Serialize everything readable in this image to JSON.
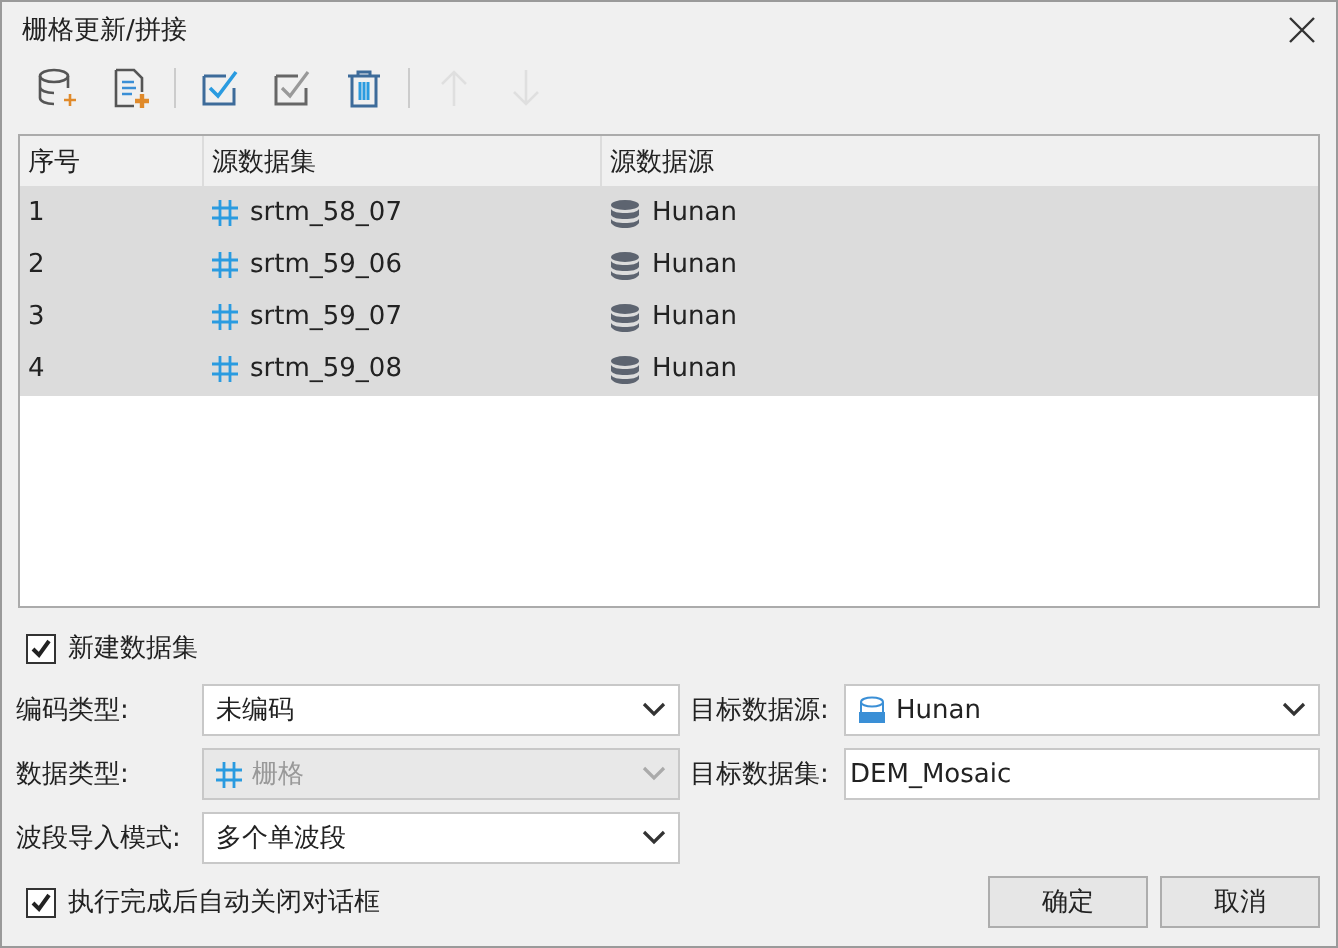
{
  "window": {
    "title": "栅格更新/拼接"
  },
  "toolbar": [
    {
      "kind": "add-datasource",
      "disabled": false
    },
    {
      "kind": "add-file",
      "disabled": false
    },
    {
      "kind": "select-all",
      "disabled": false
    },
    {
      "kind": "select-inverse",
      "disabled": false
    },
    {
      "kind": "delete",
      "disabled": false
    },
    {
      "kind": "up",
      "disabled": true
    },
    {
      "kind": "down",
      "disabled": true
    }
  ],
  "table": {
    "columns": [
      "序号",
      "源数据集",
      "源数据源"
    ],
    "rows": [
      {
        "index": "1",
        "dataset": "srtm_58_07",
        "datasource": "Hunan",
        "selected": true
      },
      {
        "index": "2",
        "dataset": "srtm_59_06",
        "datasource": "Hunan",
        "selected": true
      },
      {
        "index": "3",
        "dataset": "srtm_59_07",
        "datasource": "Hunan",
        "selected": true
      },
      {
        "index": "4",
        "dataset": "srtm_59_08",
        "datasource": "Hunan",
        "selected": true
      }
    ]
  },
  "new_dataset": {
    "label": "新建数据集",
    "checked": true
  },
  "encoding": {
    "label": "编码类型:",
    "value": "未编码"
  },
  "data_type": {
    "label": "数据类型:",
    "value": "栅格",
    "disabled": true
  },
  "band_mode": {
    "label": "波段导入模式:",
    "value": "多个单波段"
  },
  "target_datasource": {
    "label": "目标数据源:",
    "value": "Hunan"
  },
  "target_dataset": {
    "label": "目标数据集:",
    "value": "DEM_Mosaic"
  },
  "auto_close": {
    "label": "执行完成后自动关闭对话框",
    "checked": true
  },
  "buttons": [
    "确定",
    "取消"
  ]
}
